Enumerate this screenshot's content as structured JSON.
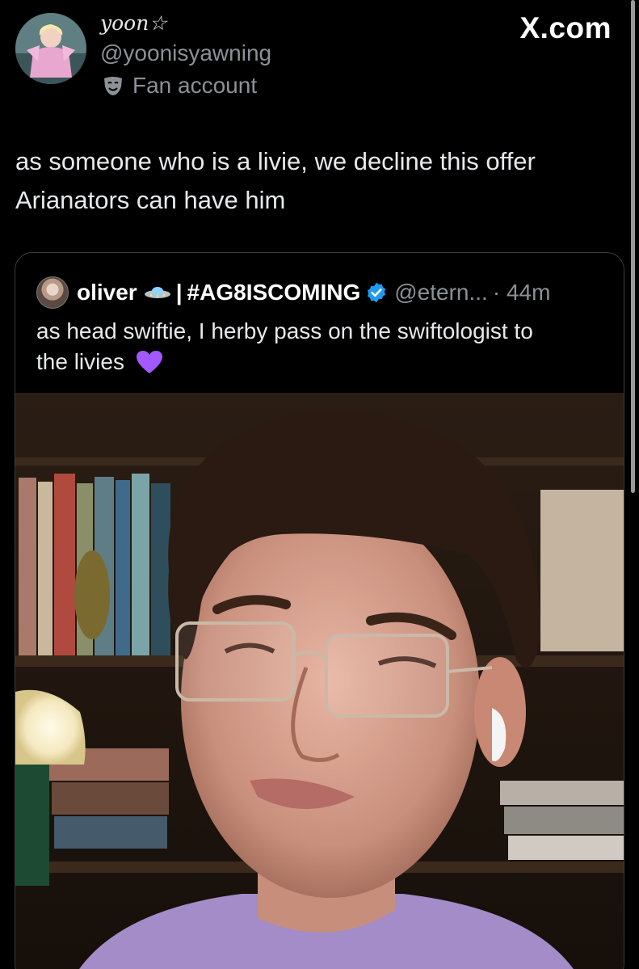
{
  "header": {
    "display_name": "yoon☆",
    "handle": "@yoonisyawning",
    "fan_label": "Fan account",
    "site": "X.com"
  },
  "tweet": {
    "line1": "as someone who is a livie, we decline this offer",
    "line2": "Arianators can have him"
  },
  "quote": {
    "name": "oliver",
    "separator": "|",
    "tag": "#AG8ISCOMING",
    "handle": "@etern...",
    "time": "· 44m",
    "text_line1": "as head swiftie, I herby pass on the swiftologist to",
    "text_line2": "the livies"
  },
  "icons": {
    "fan": "theater-mask-icon",
    "ufo": "ufo-emoji-icon",
    "verified": "verified-badge-icon",
    "heart": "purple-heart-icon"
  },
  "colors": {
    "background": "#000000",
    "text": "#e7e9ea",
    "secondary": "#8b9197",
    "verified": "#1d9bf0",
    "heart": "#a259ff"
  }
}
